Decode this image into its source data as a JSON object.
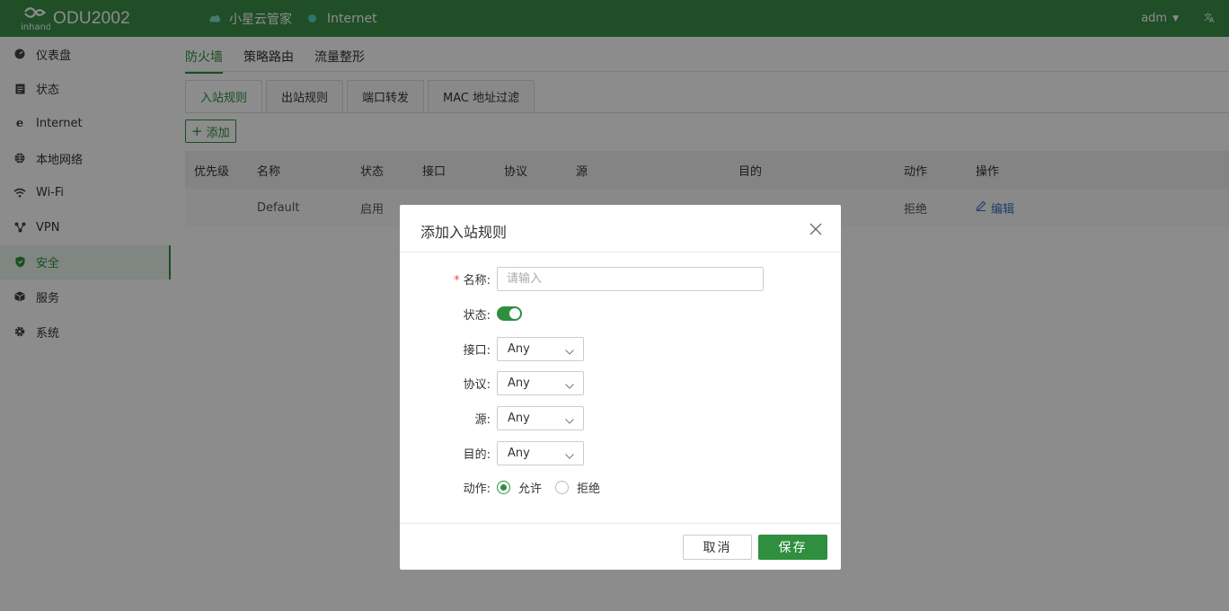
{
  "header": {
    "brand_small": "inhand",
    "model": "ODU2002",
    "cloud_label": "小星云管家",
    "internet_label": "Internet",
    "user": "adm",
    "lang_icon": "translate-icon"
  },
  "sidebar": {
    "items": [
      {
        "label": "仪表盘",
        "icon": "dashboard-icon"
      },
      {
        "label": "状态",
        "icon": "status-icon"
      },
      {
        "label": "Internet",
        "icon": "internet-icon"
      },
      {
        "label": "本地网络",
        "icon": "globe-icon"
      },
      {
        "label": "Wi-Fi",
        "icon": "wifi-icon"
      },
      {
        "label": "VPN",
        "icon": "vpn-icon"
      },
      {
        "label": "安全",
        "icon": "shield-icon",
        "active": true
      },
      {
        "label": "服务",
        "icon": "cube-icon"
      },
      {
        "label": "系统",
        "icon": "gear-icon"
      }
    ]
  },
  "main": {
    "top_tabs": [
      "防火墙",
      "策略路由",
      "流量整形"
    ],
    "sub_tabs": [
      "入站规则",
      "出站规则",
      "端口转发",
      "MAC 地址过滤"
    ],
    "add_label": "添加",
    "table": {
      "headers": [
        "优先级",
        "名称",
        "状态",
        "接口",
        "协议",
        "源",
        "目的",
        "动作",
        "操作"
      ],
      "rows": [
        {
          "priority": "",
          "name": "Default",
          "status": "启用",
          "interface": "",
          "protocol": "",
          "source": "",
          "dest": "",
          "action": "拒绝",
          "op": "编辑"
        }
      ]
    }
  },
  "modal": {
    "title": "添加入站规则",
    "fields": {
      "name_label": "名称:",
      "name_placeholder": "请输入",
      "status_label": "状态:",
      "status_on": true,
      "interface_label": "接口:",
      "interface_value": "Any",
      "protocol_label": "协议:",
      "protocol_value": "Any",
      "source_label": "源:",
      "source_value": "Any",
      "dest_label": "目的:",
      "dest_value": "Any",
      "action_label": "动作:",
      "action_allow": "允许",
      "action_deny": "拒绝",
      "action_selected": "允许"
    },
    "cancel_label": "取消",
    "save_label": "保存"
  },
  "colors": {
    "header_bg": "#3a8e48",
    "accent": "#2f8f3f",
    "link": "#3d6bc7",
    "required": "#e64b4b"
  }
}
